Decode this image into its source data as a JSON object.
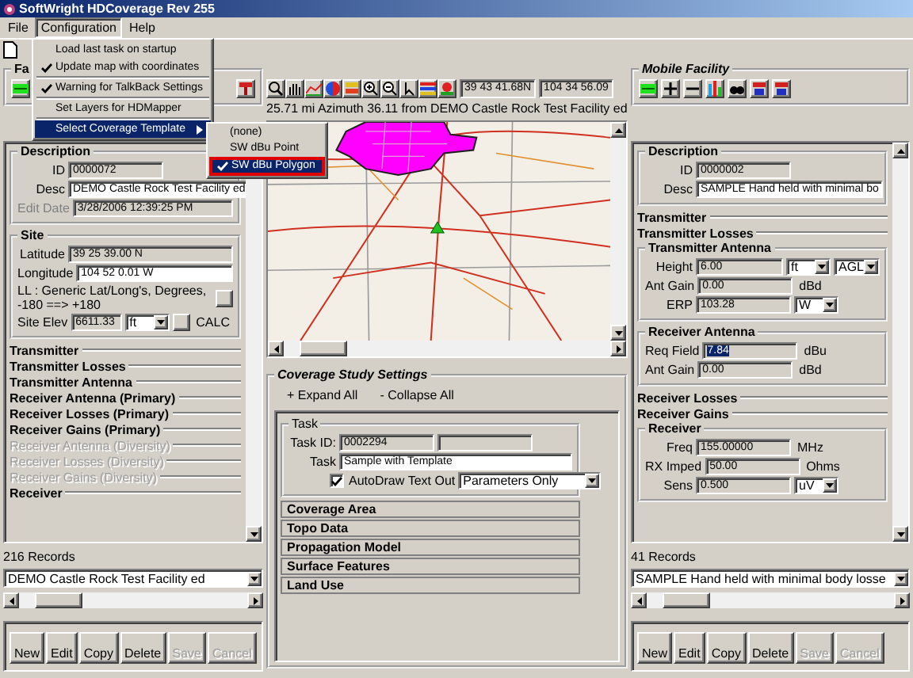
{
  "window": {
    "title": "SoftWright HDCoverage Rev 255"
  },
  "menu_bar": [
    {
      "label": "File",
      "selected": false
    },
    {
      "label": "Configuration",
      "selected": true
    },
    {
      "label": "Help",
      "selected": false
    }
  ],
  "menu": [
    {
      "kind": "item",
      "label": "Load last task on startup",
      "checked": false,
      "selected": false
    },
    {
      "kind": "item",
      "label": "Update map with coordinates",
      "checked": true,
      "selected": false
    },
    {
      "kind": "separator"
    },
    {
      "kind": "item",
      "label": "Warning for TalkBack Settings",
      "checked": true,
      "selected": false
    },
    {
      "kind": "separator"
    },
    {
      "kind": "item",
      "label": "Set Layers for HDMapper",
      "checked": false,
      "selected": false
    },
    {
      "kind": "separator"
    },
    {
      "kind": "submenu",
      "label": "Select Coverage Template",
      "checked": false,
      "selected": true
    }
  ],
  "submenu": [
    {
      "label": "(none)",
      "checked": false,
      "selected": false
    },
    {
      "label": "SW dBu Point",
      "checked": false,
      "selected": false
    },
    {
      "label": "SW dBu Polygon",
      "checked": true,
      "selected": true
    }
  ],
  "left": {
    "group_title": "Fa",
    "panel": [
      {
        "title": "Description",
        "expanded": true,
        "disabled": false,
        "rows": [
          {
            "items": [
              {
                "kind": "label",
                "text": "ID"
              },
              {
                "kind": "field",
                "value": "0000072",
                "disabled": true
              }
            ]
          },
          {
            "items": [
              {
                "kind": "label",
                "text": "Desc"
              },
              {
                "kind": "field",
                "value": "DEMO Castle Rock Test Facility ed",
                "disabled": false
              }
            ]
          },
          {
            "items": [
              {
                "kind": "label",
                "text": "Edit Date",
                "disabled": true
              },
              {
                "kind": "field",
                "value": "3/28/2006 12:39:25 PM",
                "disabled": true
              }
            ]
          }
        ]
      },
      {
        "title": "Site",
        "expanded": true,
        "disabled": false,
        "rows": [
          {
            "items": [
              {
                "kind": "label",
                "text": "Latitude"
              },
              {
                "kind": "field",
                "value": "39 25 39.00 N",
                "disabled": true
              }
            ]
          },
          {
            "items": [
              {
                "kind": "label",
                "text": "Longitude"
              },
              {
                "kind": "field",
                "value": "104 52 0.01 W",
                "disabled": false
              }
            ]
          },
          {
            "items": [
              {
                "kind": "note",
                "text": "LL : Generic Lat/Long's, Degrees, -180 ==> +180"
              },
              {
                "kind": "button"
              }
            ]
          },
          {
            "items": [
              {
                "kind": "label",
                "text": "Site Elev"
              },
              {
                "kind": "field",
                "value": "6611.33",
                "disabled": true
              },
              {
                "kind": "select",
                "value": "ft"
              },
              {
                "kind": "button"
              },
              {
                "kind": "unit",
                "text": "CALC"
              }
            ]
          }
        ]
      },
      {
        "title": "Transmitter",
        "expanded": false,
        "disabled": false
      },
      {
        "title": "Transmitter Losses",
        "expanded": false,
        "disabled": false
      },
      {
        "title": "Transmitter Antenna",
        "expanded": false,
        "disabled": false
      },
      {
        "title": "Receiver Antenna (Primary)",
        "expanded": false,
        "disabled": false
      },
      {
        "title": "Receiver Losses (Primary)",
        "expanded": false,
        "disabled": false
      },
      {
        "title": "Receiver Gains (Primary)",
        "expanded": false,
        "disabled": false
      },
      {
        "title": "Receiver Antenna (Diversity)",
        "expanded": false,
        "disabled": true
      },
      {
        "title": "Receiver Losses (Diversity)",
        "expanded": false,
        "disabled": true
      },
      {
        "title": "Receiver Gains (Diversity)",
        "expanded": false,
        "disabled": true
      },
      {
        "title": "Receiver",
        "expanded": false,
        "disabled": false
      }
    ],
    "records": "216 Records",
    "record_select": "DEMO Castle Rock Test Facility ed",
    "buttons": [
      {
        "label": "New",
        "disabled": false
      },
      {
        "label": "Edit",
        "disabled": false
      },
      {
        "label": "Copy",
        "disabled": false
      },
      {
        "label": "Delete",
        "disabled": false
      },
      {
        "label": "Save",
        "disabled": true
      },
      {
        "label": "Cancel",
        "disabled": true
      }
    ]
  },
  "map": {
    "latitude": "39 43 41.68N",
    "longitude": "104 34 56.09",
    "status": "25.71 mi Azimuth 36.11 from DEMO Castle Rock Test Facility ed"
  },
  "coverage": {
    "title": "Coverage Study Settings",
    "expand": "+ Expand All",
    "collapse": "- Collapse All",
    "task": {
      "title": "Task",
      "rows": [
        {
          "items": [
            {
              "kind": "label",
              "text": "Task ID:"
            },
            {
              "kind": "field",
              "value": "0002294",
              "disabled": true
            },
            {
              "kind": "field",
              "disabled": true
            }
          ]
        },
        {
          "items": [
            {
              "kind": "label",
              "text": "Task"
            },
            {
              "kind": "field",
              "value": "Sample with Template",
              "disabled": false
            }
          ]
        },
        {
          "items": [
            {
              "kind": "checkbox",
              "text": "AutoDraw",
              "checked": true
            },
            {
              "kind": "label",
              "text": "Text Out"
            },
            {
              "kind": "select",
              "value": "Parameters Only"
            }
          ]
        }
      ]
    },
    "sections": [
      {
        "title": "Coverage Area",
        "expanded": false
      },
      {
        "title": "Topo Data",
        "expanded": false
      },
      {
        "title": "Propagation Model",
        "expanded": false
      },
      {
        "title": "Surface Features",
        "expanded": false
      },
      {
        "title": "Land Use",
        "expanded": false
      }
    ]
  },
  "right": {
    "group_title": "Mobile Facility",
    "panel": [
      {
        "title": "Description",
        "expanded": true,
        "disabled": false,
        "rows": [
          {
            "items": [
              {
                "kind": "label",
                "text": "ID"
              },
              {
                "kind": "field",
                "value": "0000002",
                "disabled": true
              }
            ]
          },
          {
            "items": [
              {
                "kind": "label",
                "text": "Desc"
              },
              {
                "kind": "field",
                "value": "SAMPLE Hand held with minimal bo",
                "disabled": false
              }
            ]
          }
        ]
      },
      {
        "title": "Transmitter",
        "expanded": false,
        "disabled": false
      },
      {
        "title": "Transmitter Losses",
        "expanded": false,
        "disabled": false
      },
      {
        "title": "Transmitter Antenna",
        "expanded": true,
        "disabled": false,
        "rows": [
          {
            "items": [
              {
                "kind": "label",
                "text": "Height"
              },
              {
                "kind": "field",
                "value": "6.00",
                "disabled": true
              },
              {
                "kind": "select",
                "value": "ft"
              },
              {
                "kind": "select",
                "value": "AGL"
              }
            ]
          },
          {
            "items": [
              {
                "kind": "label",
                "text": "Ant Gain"
              },
              {
                "kind": "field",
                "value": "0.00",
                "disabled": true
              },
              {
                "kind": "unit",
                "text": "dBd"
              }
            ]
          },
          {
            "items": [
              {
                "kind": "label",
                "text": "ERP"
              },
              {
                "kind": "field",
                "value": "103.28",
                "disabled": true
              },
              {
                "kind": "select",
                "value": "W"
              }
            ]
          }
        ]
      },
      {
        "title": "Receiver Antenna",
        "expanded": true,
        "disabled": false,
        "rows": [
          {
            "items": [
              {
                "kind": "label",
                "text": "Req Field"
              },
              {
                "kind": "field",
                "value": "7.84",
                "disabled": true,
                "selected": true
              },
              {
                "kind": "unit",
                "text": "dBu"
              }
            ]
          },
          {
            "items": [
              {
                "kind": "label",
                "text": "Ant Gain"
              },
              {
                "kind": "field",
                "value": "0.00",
                "disabled": true
              },
              {
                "kind": "unit",
                "text": "dBd"
              }
            ]
          }
        ]
      },
      {
        "title": "Receiver Losses",
        "expanded": false,
        "disabled": false
      },
      {
        "title": "Receiver Gains",
        "expanded": false,
        "disabled": false
      },
      {
        "title": "Receiver",
        "expanded": true,
        "disabled": false,
        "rows": [
          {
            "items": [
              {
                "kind": "label",
                "text": "Freq"
              },
              {
                "kind": "field",
                "value": "155.00000",
                "disabled": true
              },
              {
                "kind": "unit",
                "text": "MHz"
              }
            ]
          },
          {
            "items": [
              {
                "kind": "label",
                "text": "RX Imped"
              },
              {
                "kind": "field",
                "value": "50.00",
                "disabled": true
              },
              {
                "kind": "unit",
                "text": "Ohms"
              }
            ]
          },
          {
            "items": [
              {
                "kind": "label",
                "text": "Sens"
              },
              {
                "kind": "field",
                "value": "0.500",
                "disabled": true
              },
              {
                "kind": "select",
                "value": "uV"
              }
            ]
          }
        ]
      }
    ],
    "records": "41 Records",
    "record_select": "SAMPLE Hand held with minimal body losse",
    "buttons": [
      {
        "label": "New",
        "disabled": false
      },
      {
        "label": "Edit",
        "disabled": false
      },
      {
        "label": "Copy",
        "disabled": false
      },
      {
        "label": "Delete",
        "disabled": false
      },
      {
        "label": "Save",
        "disabled": true
      },
      {
        "label": "Cancel",
        "disabled": true
      }
    ]
  }
}
